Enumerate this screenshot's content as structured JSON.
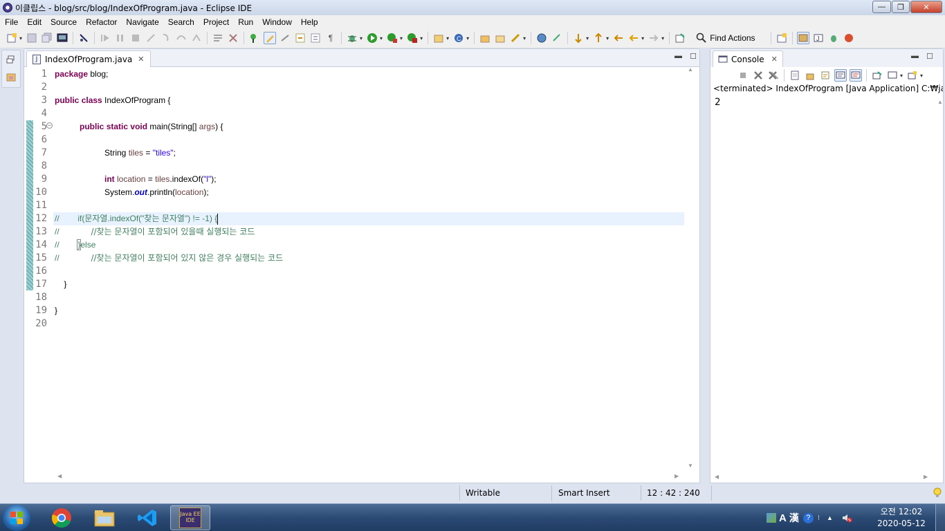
{
  "window": {
    "title": "이클립스 - blog/src/blog/IndexOfProgram.java - Eclipse IDE",
    "min": "—",
    "max": "❐",
    "close": "✕"
  },
  "menu": [
    "File",
    "Edit",
    "Source",
    "Refactor",
    "Navigate",
    "Search",
    "Project",
    "Run",
    "Window",
    "Help"
  ],
  "toolbar": {
    "find_actions": "Find Actions"
  },
  "editor": {
    "tab_label": "IndexOfProgram.java",
    "tab_close": "✕",
    "lines": [
      "1",
      "2",
      "3",
      "4",
      "5",
      "6",
      "7",
      "8",
      "9",
      "10",
      "11",
      "12",
      "13",
      "14",
      "15",
      "16",
      "17",
      "18",
      "19",
      "20"
    ]
  },
  "code": {
    "l1": {
      "kw": "package",
      "rest": " blog;"
    },
    "l3": {
      "kw1": "public",
      "kw2": "class",
      "rest": " IndexOfProgram {"
    },
    "l5": {
      "kw1": "public",
      "kw2": "static",
      "kw3": "void",
      "rest1": " main(String[] ",
      "param": "args",
      "rest2": ") {"
    },
    "l7": {
      "type": "String ",
      "var": "tiles",
      "mid": " = ",
      "str": "\"tiles\"",
      "end": ";"
    },
    "l9": {
      "kw": "int",
      "var": " location",
      "mid": " = ",
      "var2": "tiles",
      "call": ".indexOf(",
      "str": "\"l\"",
      "end": ");"
    },
    "l10": {
      "pre": "System.",
      "fld": "out",
      "call": ".println(",
      "var": "location",
      "end": ");"
    },
    "l12": {
      "cm": "//",
      "body": "        if(문자열.indexOf(\"찾는 문자열\") != -1) {"
    },
    "l13": {
      "cm": "//",
      "body": "            //찾는 문자열이 포함되어 있을때 실행되는 코드"
    },
    "l14": {
      "cm": "//",
      "pre": "        ",
      "brace": "}",
      "body": "else"
    },
    "l15": {
      "cm": "//",
      "body": "            //찾는 문자열이 포함되어 있지 않은 경우 실행되는 코드"
    },
    "l17": {
      "body": "    }"
    },
    "l19": {
      "body": "}"
    }
  },
  "console": {
    "tab_label": "Console",
    "tab_close": "✕",
    "status": "<terminated> IndexOfProgram [Java Application] C:₩java₩bir",
    "output": "2"
  },
  "statusbar": {
    "writable": "Writable",
    "insert_mode": "Smart Insert",
    "position": "12 : 42 : 240"
  },
  "taskbar": {
    "eclipse_label": "Java EE IDE",
    "tray_lang": "A",
    "tray_hanja": "漢",
    "tray_help": "?"
  },
  "clock": {
    "time": "오전 12:02",
    "date": "2020-05-12"
  }
}
